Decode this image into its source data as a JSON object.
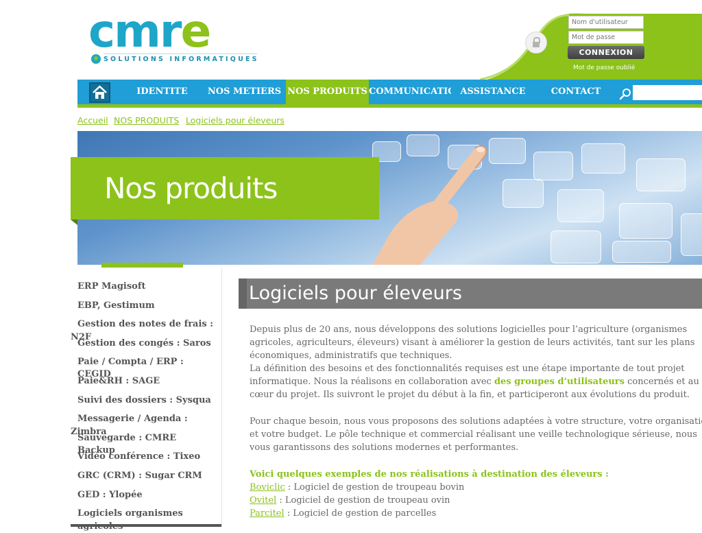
{
  "brand": {
    "logo_word_a": "cmr",
    "logo_word_b": "e",
    "tagline": "SOLUTIONS INFORMATIQUES"
  },
  "login": {
    "username_placeholder": "Nom d'utilisateur",
    "password_placeholder": "Mot de passe",
    "connect_label": "CONNEXION",
    "forgot_label": "Mot de passe oublié"
  },
  "nav": {
    "items": [
      "IDENTITE",
      "NOS METIERS",
      "NOS PRODUITS",
      "COMMUNICATION",
      "ASSISTANCE",
      "CONTACT"
    ],
    "active": "NOS PRODUITS"
  },
  "breadcrumb": [
    "Accueil",
    "NOS PRODUITS",
    "Logiciels pour éleveurs"
  ],
  "banner": {
    "title": "Nos produits"
  },
  "sidebar": {
    "items": [
      "ERP Magisoft",
      "EBP, Gestimum",
      "Gestion des notes de frais :",
      "N2F",
      "Gestion des congés : Saros",
      "Paie / Compta / ERP : CEGID",
      "Paie&RH : SAGE",
      "Suivi des dossiers : Sysqua",
      "Messagerie / Agenda :",
      "Zimbra",
      "Sauvegarde : CMRE Backup",
      "Vidéo conférence : Tixeo",
      "GRC (CRM) : Sugar CRM",
      "GED : Ylopée",
      "Logiciels organismes",
      "agricoles"
    ]
  },
  "main": {
    "title": "Logiciels pour éleveurs",
    "p1": [
      "Depuis plus de 20 ans, nous développons des solutions logicielles pour l’agriculture (organismes",
      "agricoles, agriculteurs, éleveurs) visant à améliorer la gestion de leurs activités, tant sur les plans",
      "économiques, administratifs que techniques."
    ],
    "p2_line1": "La définition des besoins et des fonctionnalités requises est une étape importante de tout projet",
    "p2_line2_before": "informatique. Nous la réalisons en collaboration avec ",
    "p2_line2_link": "des groupes d’utilisateurs",
    "p2_line2_after": " concernés et au",
    "p2_line3": "cœur du projet. Ils suivront le projet du début à la fin, et participeront aux évolutions du produit.",
    "p3": [
      "Pour chaque besoin, nous vous proposons des solutions adaptées à votre structure, votre organisation",
      "et votre budget. Le pôle technique et commercial réalisant une veille technologique sérieuse, nous",
      "vous garantissons des solutions modernes et performantes."
    ],
    "examples_heading": "Voici quelques exemples de nos réalisations à destination des éleveurs  :",
    "examples": [
      {
        "name": "Boviclic",
        "desc": " : Logiciel de gestion de troupeau bovin"
      },
      {
        "name": "Ovitel",
        "desc": " : Logiciel de gestion de troupeau ovin"
      },
      {
        "name": "Parcitel",
        "desc": " : Logiciel de gestion de parcelles"
      }
    ]
  },
  "colors": {
    "brand_blue": "#1f9ed7",
    "brand_green": "#8cc21a",
    "title_gray": "#7a7a7a",
    "text_gray": "#666666"
  },
  "icons": {
    "home": "home-icon",
    "search": "search-icon",
    "lock": "lock-icon"
  }
}
